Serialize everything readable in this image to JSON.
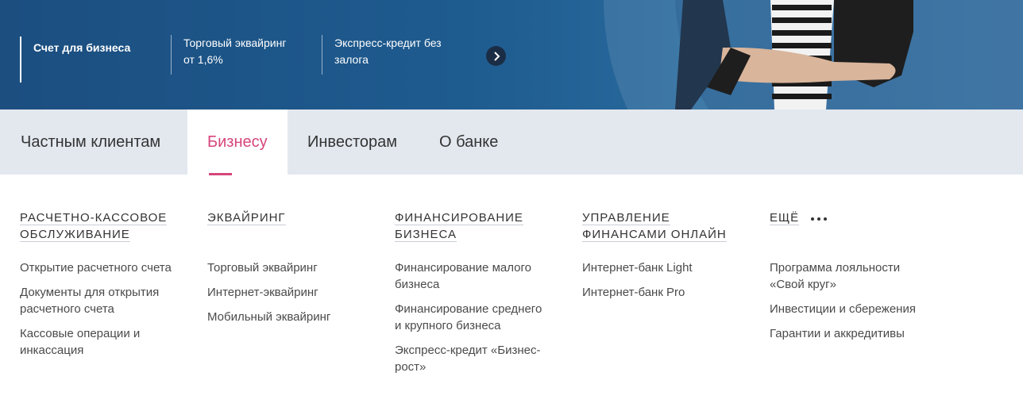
{
  "hero": {
    "promos": [
      {
        "label": "Счет для бизнеса"
      },
      {
        "label": "Торговый эквайринг\nот 1,6%"
      },
      {
        "label": "Экспресс-кредит без\nзалога"
      }
    ],
    "next_icon": "chevron-right-icon"
  },
  "nav": {
    "tabs": [
      {
        "label": "Частным клиентам"
      },
      {
        "label": "Бизнесу"
      },
      {
        "label": "Инвесторам"
      },
      {
        "label": "О банке"
      }
    ],
    "active_color": "#d6457b"
  },
  "menu": {
    "columns": [
      {
        "heading_lines": [
          "РАСЧЕТНО-КАССОВОЕ",
          "ОБСЛУЖИВАНИЕ"
        ],
        "links": [
          "Открытие расчетного счета",
          "Документы для открытия\nрасчетного счета",
          "Кассовые операции и\nинкассация"
        ]
      },
      {
        "heading_lines": [
          "ЭКВАЙРИНГ"
        ],
        "links": [
          "Торговый эквайринг",
          "Интернет-эквайринг",
          "Мобильный эквайринг"
        ]
      },
      {
        "heading_lines": [
          "ФИНАНСИРОВАНИЕ",
          "БИЗНЕСА"
        ],
        "links": [
          "Финансирование малого\nбизнеса",
          "Финансирование среднего\nи крупного бизнеса",
          "Экспресс-кредит «Бизнес-\nрост»"
        ]
      },
      {
        "heading_lines": [
          "УПРАВЛЕНИЕ",
          "ФИНАНСАМИ ОНЛАЙН"
        ],
        "links": [
          "Интернет-банк Light",
          "Интернет-банк Pro"
        ]
      },
      {
        "heading_lines": [
          "ЕЩЁ"
        ],
        "links": [
          "Программа лояльности\n«Свой круг»",
          "Инвестиции и сбережения",
          "Гарантии и аккредитивы"
        ]
      }
    ],
    "more_icon": "more-dots-icon"
  }
}
